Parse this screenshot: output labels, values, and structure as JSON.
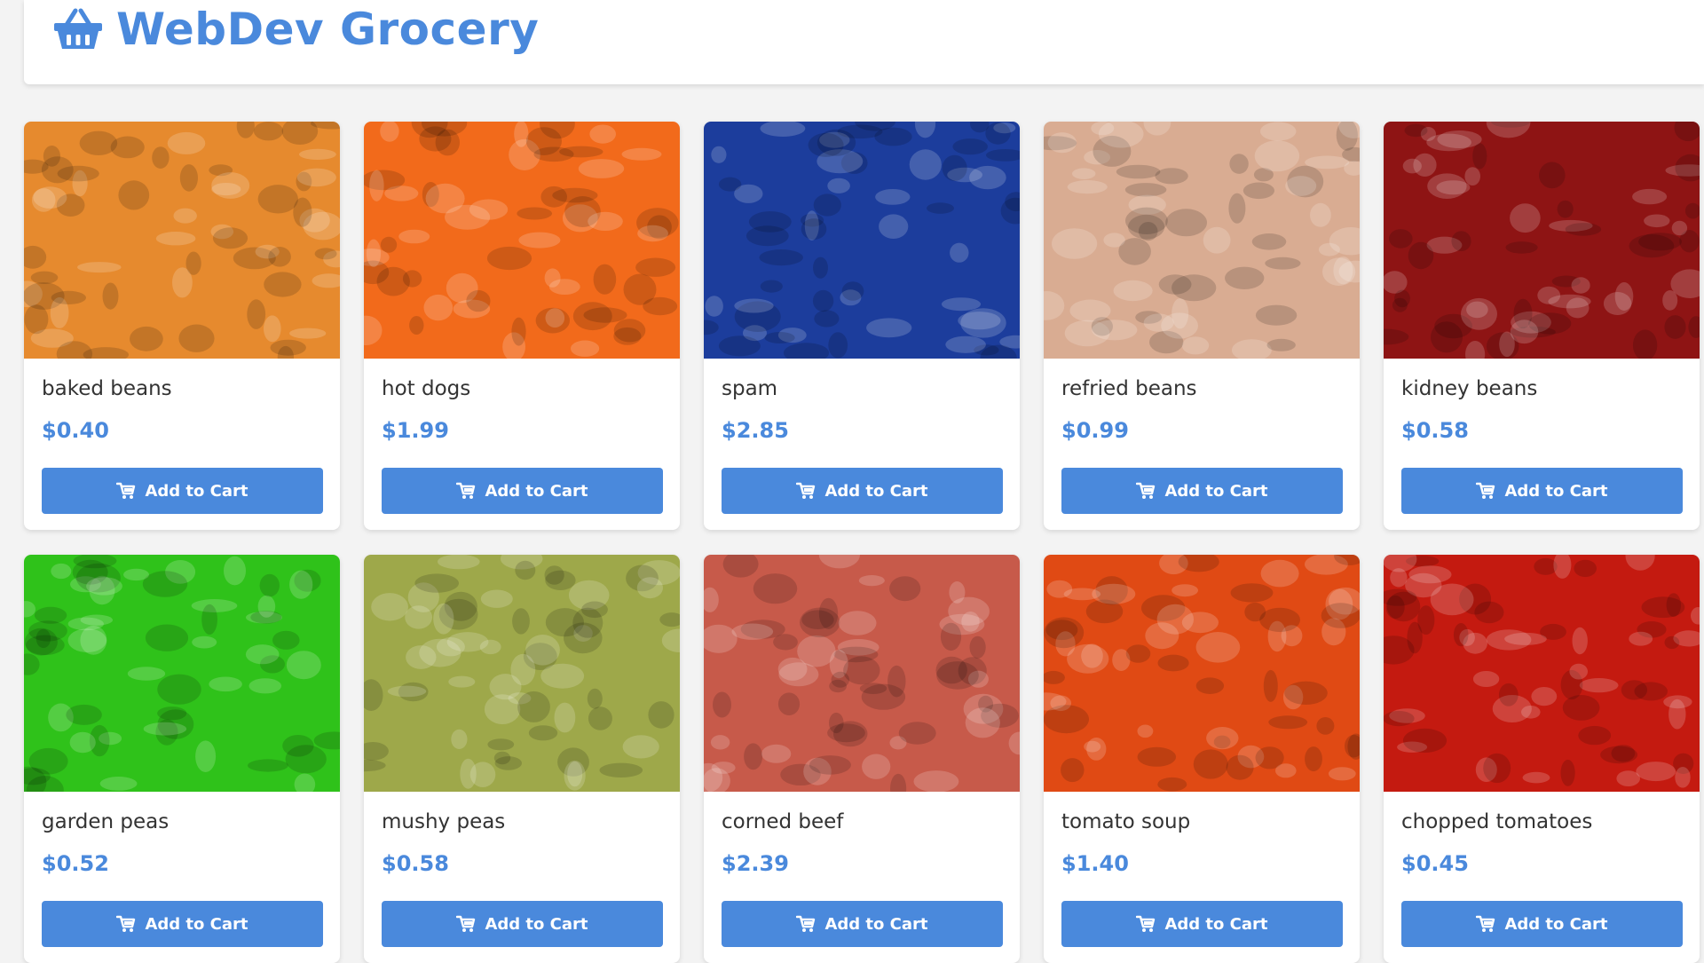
{
  "header": {
    "title": "WebDev Grocery",
    "logo_icon": "basket-icon"
  },
  "theme": {
    "accent": "#4a89dc",
    "text": "#333333",
    "background": "#f3f3f3"
  },
  "products": [
    {
      "name": "baked beans",
      "price": "$0.40",
      "button": "Add to Cart",
      "image_color": "#e68a2e"
    },
    {
      "name": "hot dogs",
      "price": "$1.99",
      "button": "Add to Cart",
      "image_color": "#f26a1b"
    },
    {
      "name": "spam",
      "price": "$2.85",
      "button": "Add to Cart",
      "image_color": "#1c3d9c"
    },
    {
      "name": "refried beans",
      "price": "$0.99",
      "button": "Add to Cart",
      "image_color": "#d9ac92"
    },
    {
      "name": "kidney beans",
      "price": "$0.58",
      "button": "Add to Cart",
      "image_color": "#8e1414"
    },
    {
      "name": "garden peas",
      "price": "$0.52",
      "button": "Add to Cart",
      "image_color": "#2fc21a"
    },
    {
      "name": "mushy peas",
      "price": "$0.58",
      "button": "Add to Cart",
      "image_color": "#9ea84a"
    },
    {
      "name": "corned beef",
      "price": "$2.39",
      "button": "Add to Cart",
      "image_color": "#c75a4a"
    },
    {
      "name": "tomato soup",
      "price": "$1.40",
      "button": "Add to Cart",
      "image_color": "#e04a14"
    },
    {
      "name": "chopped tomatoes",
      "price": "$0.45",
      "button": "Add to Cart",
      "image_color": "#c41a10"
    }
  ],
  "icons": {
    "cart": "cart-icon"
  }
}
